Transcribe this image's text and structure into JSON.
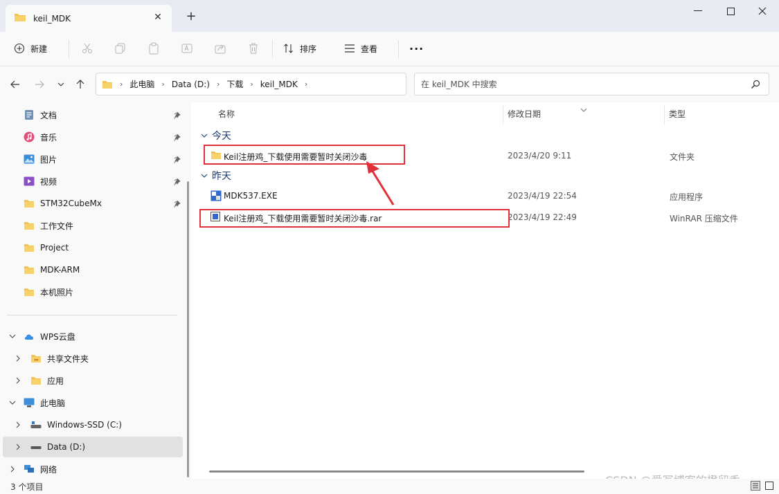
{
  "window": {
    "tab_title": "keil_MDK",
    "new_tab": "+"
  },
  "commandbar": {
    "new_label": "新建",
    "sort_label": "排序",
    "view_label": "查看",
    "more_label": "···"
  },
  "address": {
    "crumbs": [
      "此电脑",
      "Data (D:)",
      "下载",
      "keil_MDK"
    ],
    "search_placeholder": "在 keil_MDK 中搜索"
  },
  "sidebar": {
    "quick": [
      {
        "label": "文档",
        "icon": "document-icon"
      },
      {
        "label": "音乐",
        "icon": "music-icon"
      },
      {
        "label": "图片",
        "icon": "picture-icon"
      },
      {
        "label": "视频",
        "icon": "video-icon"
      },
      {
        "label": "STM32CubeMx",
        "icon": "folder-icon"
      },
      {
        "label": "工作文件",
        "icon": "folder-icon"
      },
      {
        "label": "Project",
        "icon": "folder-icon"
      },
      {
        "label": "MDK-ARM",
        "icon": "folder-icon"
      },
      {
        "label": "本机照片",
        "icon": "folder-icon"
      }
    ],
    "tree": [
      {
        "label": "WPS云盘"
      },
      {
        "label": "共享文件夹"
      },
      {
        "label": "应用"
      },
      {
        "label": "此电脑"
      },
      {
        "label": "Windows-SSD (C:)"
      },
      {
        "label": "Data (D:)"
      },
      {
        "label": "网络"
      }
    ]
  },
  "columns": {
    "name": "名称",
    "date": "修改日期",
    "type": "类型"
  },
  "groups": {
    "today": "今天",
    "yesterday": "昨天"
  },
  "files": [
    {
      "name": "Keil注册鸡_下载使用需要暂时关闭沙毒",
      "date": "2023/4/20 9:11",
      "type": "文件夹",
      "icon": "folder-icon"
    },
    {
      "name": "MDK537.EXE",
      "date": "2023/4/19 22:54",
      "type": "应用程序",
      "icon": "exe-icon"
    },
    {
      "name": "Keil注册鸡_下载使用需要暂时关闭沙毒.rar",
      "date": "2023/4/19 22:49",
      "type": "WinRAR 压缩文件",
      "icon": "rar-icon"
    }
  ],
  "watermark": "CSDN @爱写博客的橙留香",
  "status": {
    "item_count": "3 个项目"
  },
  "colors": {
    "highlight": "#e0313a",
    "folder": "#f2c14e",
    "group_text": "#1a3a6e"
  }
}
